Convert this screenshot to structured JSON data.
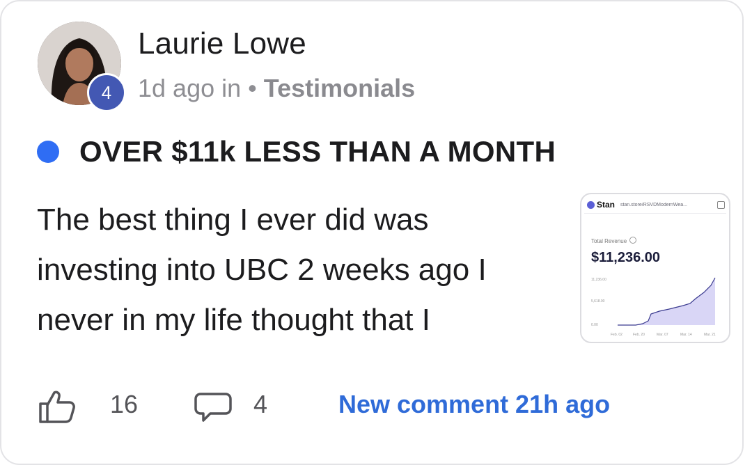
{
  "post": {
    "author": "Laurie Lowe",
    "level": "4",
    "time_prefix": "1d ago in • ",
    "category": "Testimonials",
    "title": "OVER $11k LESS THAN A MONTH",
    "body": "The best thing I ever did was investing into UBC 2 weeks ago I never in my life thought that I",
    "likes": "16",
    "comments": "4",
    "new_comment": "New comment 21h ago"
  },
  "attachment": {
    "brand": "Stan",
    "url": "stan.store/RSVDModernWea...",
    "revenue_label": "Total Revenue",
    "revenue_value": "$11,236.00",
    "y_ticks": [
      "11,236.00",
      "5,618.00",
      "0.00"
    ],
    "x_ticks": [
      "Feb. 02",
      "Feb. 20",
      "Mar. 07",
      "Mar. 14",
      "Mar. 21"
    ]
  },
  "colors": {
    "accent_blue": "#2f6bd8",
    "status_dot": "#2f6df4",
    "level_badge": "#4358b3",
    "chart_fill": "#c9c4f2",
    "chart_line": "#3a3a8f"
  },
  "icons": [
    "thumbs-up-icon",
    "comment-icon",
    "copy-icon",
    "help-icon"
  ]
}
